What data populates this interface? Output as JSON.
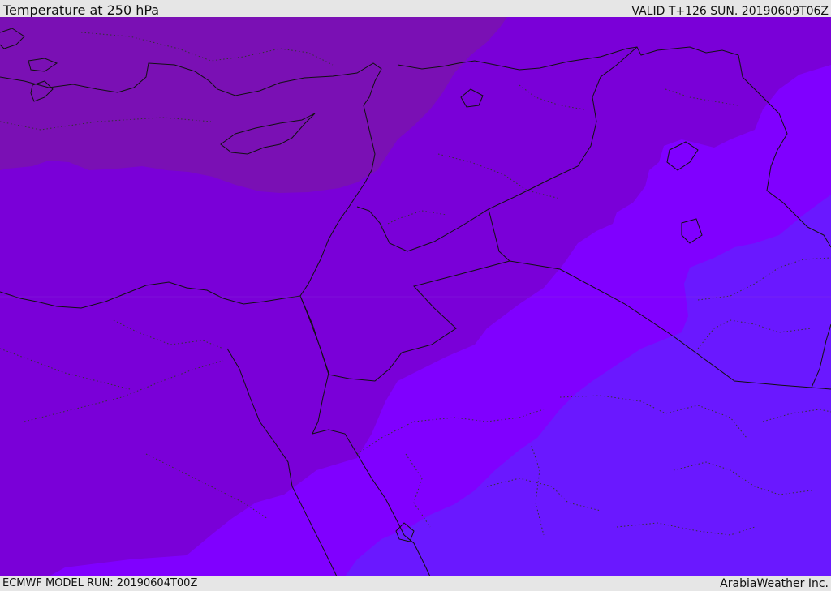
{
  "header": {
    "title": "Temperature at 250 hPa",
    "valid_time": "VALID T+126 SUN. 20190609T06Z"
  },
  "footer": {
    "model_run": "ECMWF MODEL RUN: 20190604T00Z",
    "credit": "ArabiaWeather Inc."
  },
  "map": {
    "colors": {
      "band_coldest": "#7a10b4",
      "band_cold": "#7a00d8",
      "band_mid": "#8000ff",
      "band_warm": "#6a18ff",
      "coastline": "#111111",
      "border_dotted": "#333333"
    }
  }
}
